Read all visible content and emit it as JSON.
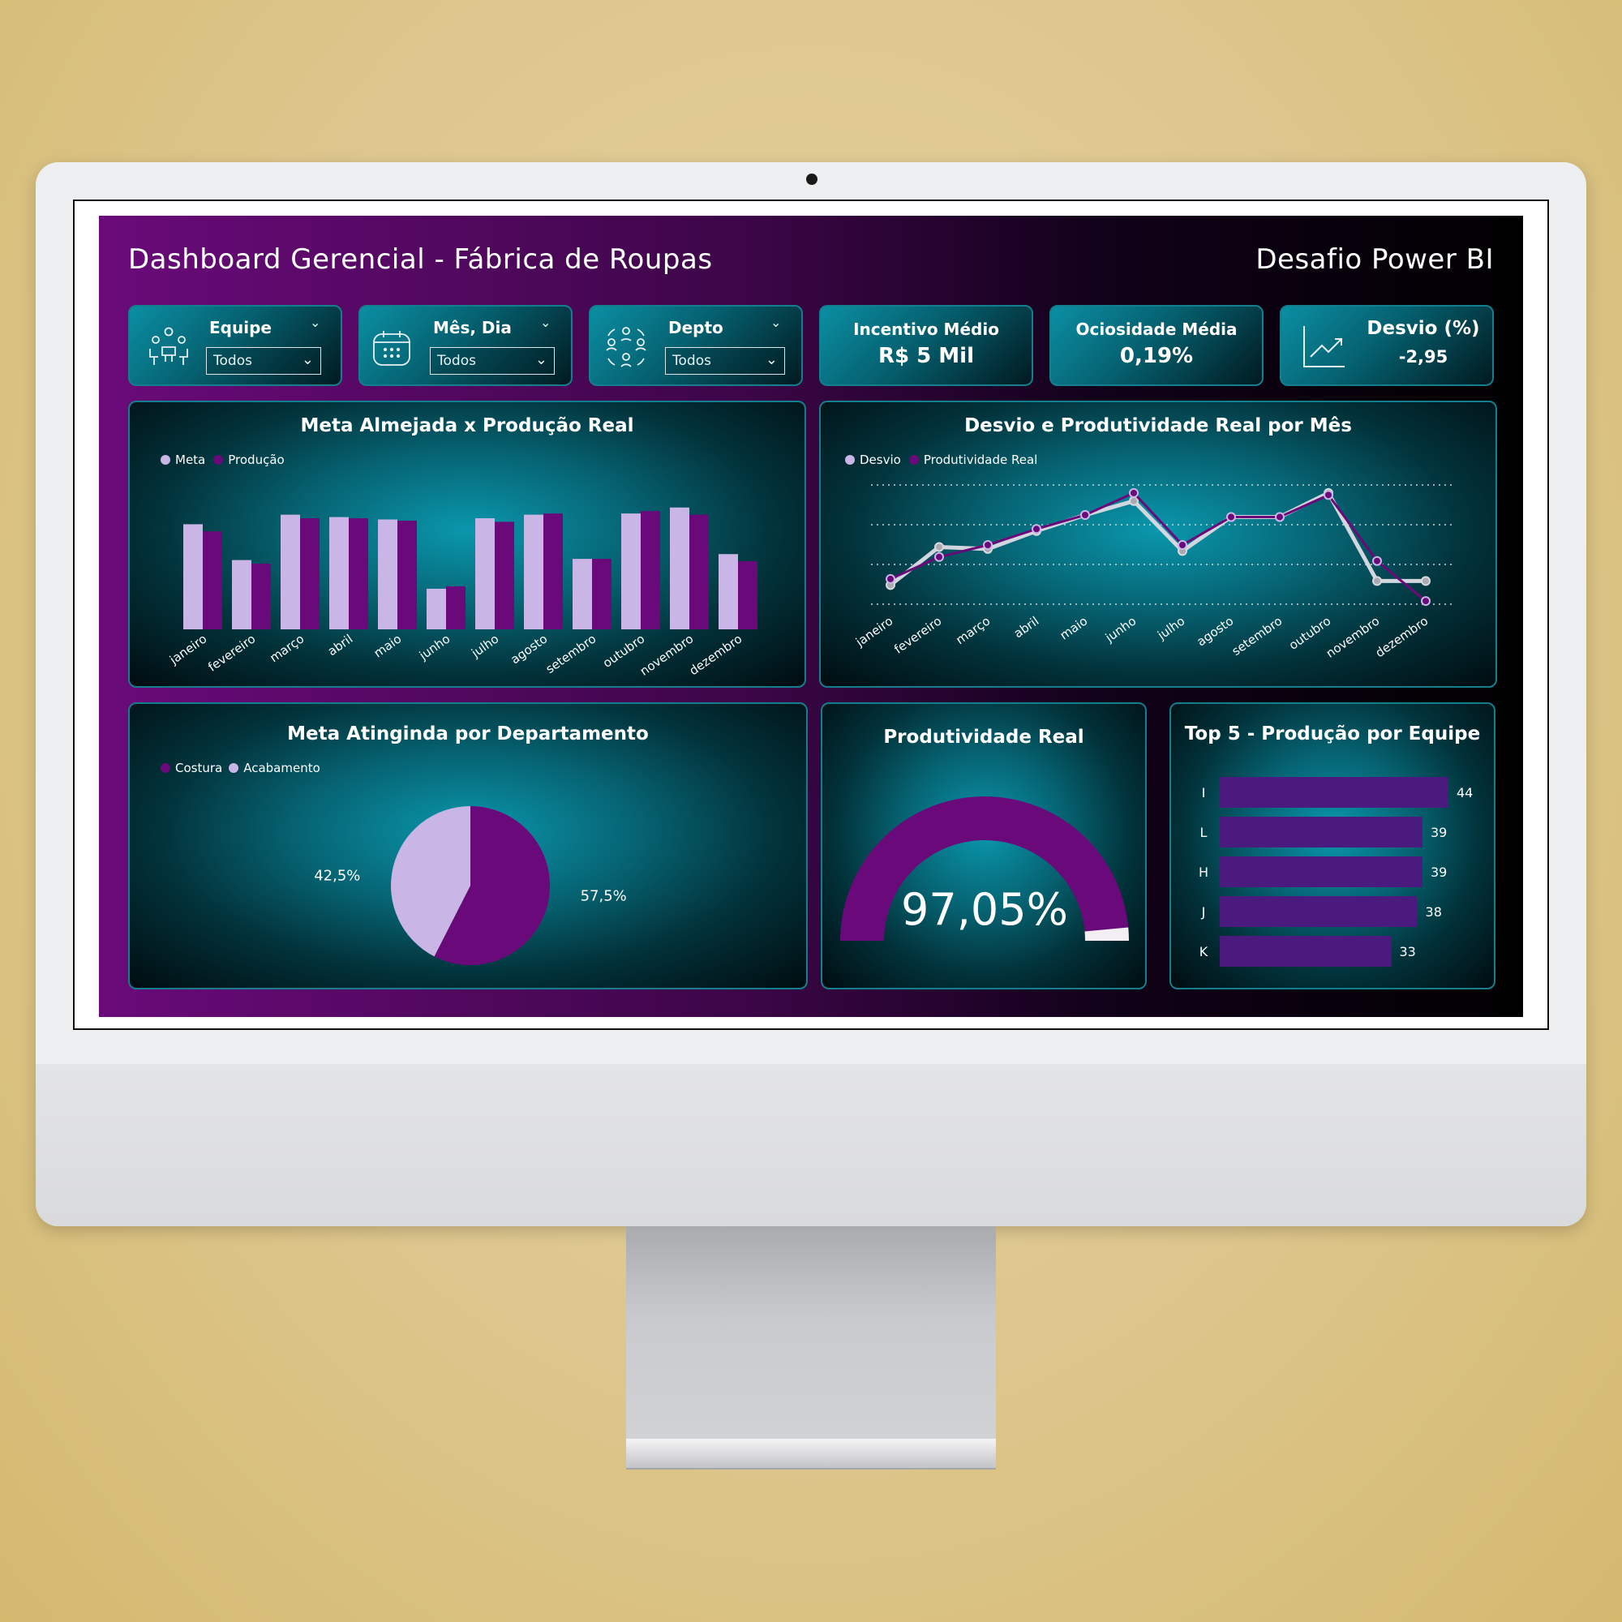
{
  "dashboard": {
    "title": "Dashboard Gerencial - Fábrica de Roupas",
    "subtitle_right": "Desafio Power BI"
  },
  "slicers": [
    {
      "label": "Equipe",
      "value": "Todos",
      "icon": "team-icon"
    },
    {
      "label": "Mês, Dia",
      "value": "Todos",
      "icon": "calendar-icon"
    },
    {
      "label": "Depto",
      "value": "Todos",
      "icon": "department-icon"
    }
  ],
  "kpis": {
    "incentivo": {
      "label": "Incentivo Médio",
      "value": "R$ 5 Mil"
    },
    "ociosidade": {
      "label": "Ociosidade Média",
      "value": "0,19%"
    },
    "desvio": {
      "label": "Desvio (%)",
      "value": "-2,95",
      "icon": "trend-chart-icon"
    }
  },
  "colors": {
    "meta": "#c9b6e6",
    "producao": "#6a0a7a",
    "accent": "#0a97ad",
    "border": "#137e8d"
  },
  "chart_data": [
    {
      "type": "bar",
      "title": "Meta Almejada x Produção Real",
      "categories": [
        "janeiro",
        "fevereiro",
        "março",
        "abril",
        "maio",
        "junho",
        "julho",
        "agosto",
        "setembro",
        "outubro",
        "novembro",
        "dezembro"
      ],
      "series": [
        {
          "name": "Meta",
          "values": [
            88,
            58,
            96,
            94,
            92,
            34,
            93,
            96,
            59,
            97,
            102,
            63
          ]
        },
        {
          "name": "Produção",
          "values": [
            82,
            55,
            93,
            93,
            91,
            36,
            90,
            97,
            59,
            99,
            96,
            57
          ]
        }
      ],
      "ylim": [
        0,
        110
      ],
      "legend": "top-left"
    },
    {
      "type": "line",
      "title": "Desvio e Produtividade Real por Mês",
      "categories": [
        "janeiro",
        "fevereiro",
        "março",
        "abril",
        "maio",
        "junho",
        "julho",
        "agosto",
        "setembro",
        "outubro",
        "novembro",
        "dezembro"
      ],
      "series": [
        {
          "name": "Desvio",
          "values": [
            0.5,
            2.4,
            2.3,
            3.2,
            4.0,
            4.7,
            2.2,
            3.9,
            3.9,
            5.1,
            0.7,
            0.7
          ]
        },
        {
          "name": "Produtividade Real",
          "values": [
            0.8,
            1.9,
            2.5,
            3.3,
            4.0,
            5.1,
            2.5,
            3.9,
            3.9,
            5.0,
            1.7,
            -0.3
          ]
        }
      ],
      "ylim": [
        -0.5,
        5.5
      ],
      "grid": true,
      "legend": "top-left"
    },
    {
      "type": "pie",
      "title": "Meta Atinginda por Departamento",
      "series": [
        {
          "name": "Costura",
          "value": 57.5,
          "label": "57,5%"
        },
        {
          "name": "Acabamento",
          "value": 42.5,
          "label": "42,5%"
        }
      ],
      "legend": "top-left"
    },
    {
      "type": "gauge",
      "title": "Produtividade Real",
      "value": 97.05,
      "label": "97,05%"
    },
    {
      "type": "bar",
      "title": "Top 5 - Produção por Equipe",
      "orientation": "horizontal",
      "categories": [
        "I",
        "L",
        "H",
        "J",
        "K"
      ],
      "values": [
        44,
        39,
        39,
        38,
        33
      ],
      "xlim": [
        0,
        44
      ]
    }
  ]
}
